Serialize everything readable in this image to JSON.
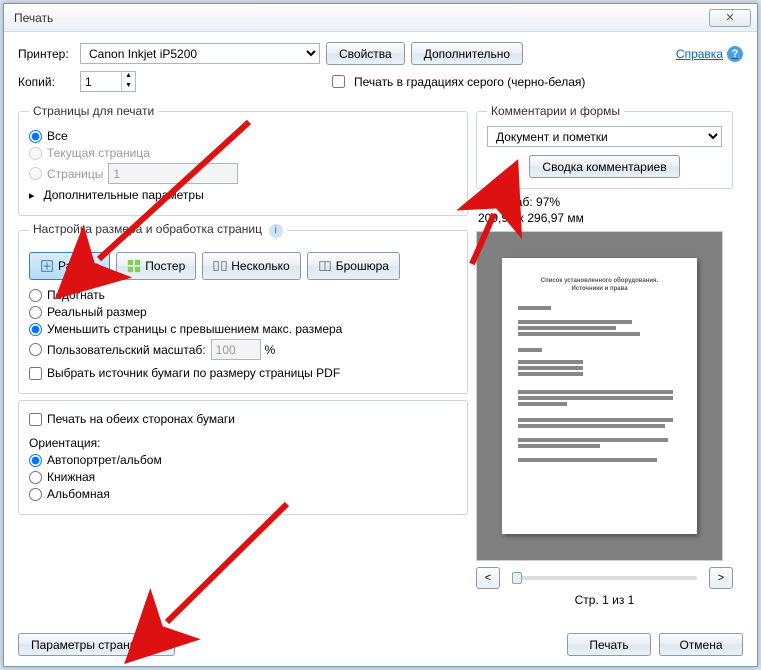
{
  "window": {
    "title": "Печать",
    "close": "✕"
  },
  "top": {
    "printer_label": "Принтер:",
    "printer_value": "Canon Inkjet iP5200",
    "properties_btn": "Свойства",
    "additional_btn": "Дополнительно",
    "help_link": "Справка",
    "copies_label": "Копий:",
    "copies_value": "1",
    "grayscale_label": "Печать в градациях серого (черно-белая)"
  },
  "pages_group": {
    "legend": "Страницы для печати",
    "all": "Все",
    "current": "Текущая страница",
    "pages": "Страницы",
    "pages_value": "1",
    "more": "Дополнительные параметры"
  },
  "sizing_group": {
    "legend": "Настройка размера и обработка страниц",
    "tabs": {
      "size": "Размер",
      "poster": "Постер",
      "multiple": "Несколько",
      "booklet": "Брошюра"
    },
    "fit": "Подогнать",
    "actual": "Реальный размер",
    "shrink": "Уменьшить страницы с превышением макс. размера",
    "custom": "Пользовательский масштаб:",
    "custom_value": "100",
    "percent": "%",
    "source": "Выбрать источник бумаги по размеру страницы PDF"
  },
  "duplex_group": {
    "duplex": "Печать на обеих сторонах бумаги",
    "orientation_label": "Ориентация:",
    "auto": "Автопортрет/альбом",
    "portrait": "Книжная",
    "landscape": "Альбомная"
  },
  "comments_group": {
    "legend": "Комментарии и формы",
    "combo_value": "Документ и пометки",
    "summary_btn": "Сводка комментариев"
  },
  "preview": {
    "scale_label": "Масштаб:",
    "scale_value": "97%",
    "dims": "209,97 x 296,97 мм",
    "doc_title": "Список установленного оборудования.",
    "doc_subtitle": "Источники и права",
    "page_info": "Стр. 1 из 1"
  },
  "footer": {
    "page_setup": "Параметры страницы...",
    "print": "Печать",
    "cancel": "Отмена"
  }
}
